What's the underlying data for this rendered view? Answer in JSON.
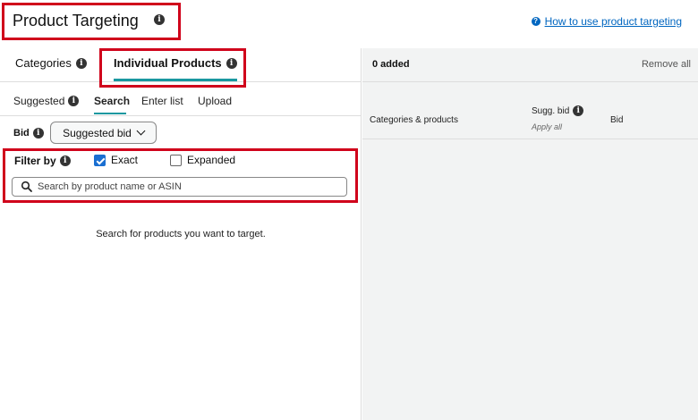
{
  "header": {
    "title": "Product Targeting",
    "help_link": "How to use product targeting"
  },
  "left_panel": {
    "top_tabs": [
      {
        "label": "Categories"
      },
      {
        "label": "Individual Products",
        "active": true
      }
    ],
    "sub_tabs": [
      {
        "label": "Suggested"
      },
      {
        "label": "Search",
        "active": true
      },
      {
        "label": "Enter list"
      },
      {
        "label": "Upload"
      }
    ],
    "bid": {
      "label": "Bid",
      "selected": "Suggested bid"
    },
    "filter": {
      "label": "Filter by",
      "options": [
        {
          "label": "Exact",
          "checked": true
        },
        {
          "label": "Expanded",
          "checked": false
        }
      ]
    },
    "search": {
      "placeholder": "Search by product name or ASIN",
      "value": ""
    },
    "empty_message": "Search for products you want to target."
  },
  "right_panel": {
    "added_count": "0 added",
    "remove_all": "Remove all",
    "columns": {
      "categories": "Categories & products",
      "sugg_bid": "Sugg. bid",
      "apply_all": "Apply all",
      "bid": "Bid"
    }
  },
  "colors": {
    "highlight_box": "#d0021b",
    "tab_underline": "#1a98a0",
    "link": "#0066c0",
    "checkbox": "#1a6fd1"
  }
}
